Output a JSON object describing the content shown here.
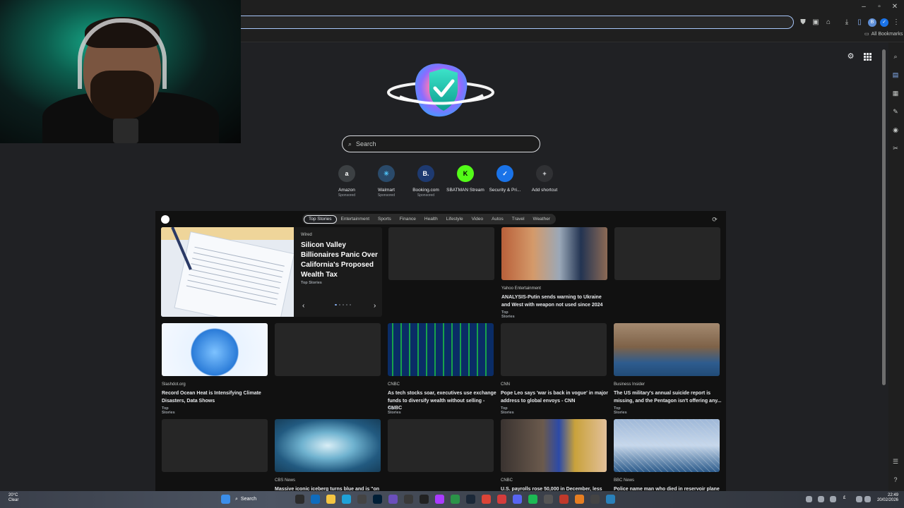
{
  "browser": {
    "bookmarks_label": "All Bookmarks",
    "window_controls": [
      "–",
      "▫",
      "✕"
    ]
  },
  "newtab": {
    "search_placeholder": "Search",
    "shortcuts": [
      {
        "label": "Amazon",
        "sub": "Sponsored",
        "icon": "a",
        "color": "#ffffff",
        "bg": "#3c4043"
      },
      {
        "label": "Walmart",
        "sub": "Sponsored",
        "icon": "✳",
        "color": "#4fc3f7",
        "bg": "#2a4a6a"
      },
      {
        "label": "Booking.com",
        "sub": "Sponsored",
        "icon": "B.",
        "color": "#ffffff",
        "bg": "#1e3a70"
      },
      {
        "label": "SBATMAN Stream",
        "sub": "",
        "icon": "K",
        "color": "#000000",
        "bg": "#53fc18"
      },
      {
        "label": "Security & Pri...",
        "sub": "",
        "icon": "✓",
        "color": "#ffffff",
        "bg": "#1a73e8"
      },
      {
        "label": "Add shortcut",
        "sub": "",
        "icon": "+",
        "color": "#e8eaed",
        "bg": "#303134"
      }
    ]
  },
  "feed": {
    "tabs": [
      "Top Stories",
      "Entertainment",
      "Sports",
      "Finance",
      "Health",
      "Lifestyle",
      "Video",
      "Autos",
      "Travel",
      "Weather"
    ],
    "hero": {
      "source": "Wired",
      "title": "Silicon Valley Billionaires Panic Over California's Proposed Wealth Tax",
      "category": "Top Stories",
      "prev": "‹",
      "next": "›"
    },
    "cards": [
      {
        "source": "",
        "title": "",
        "category": ""
      },
      {
        "source": "Yahoo Entertainment",
        "title": "ANALYSIS-Putin sends warning to Ukraine and West with weapon not used since 2024",
        "category": "Top Stories"
      },
      {
        "source": "",
        "title": "",
        "category": ""
      },
      {
        "source": "Slashdot.org",
        "title": "Record Ocean Heat is Intensifying Climate Disasters, Data Shows",
        "category": "Top Stories"
      },
      {
        "source": "",
        "title": "",
        "category": ""
      },
      {
        "source": "CNBC",
        "title": "As tech stocks soar, executives use exchange funds to diversify wealth without selling - CNBC",
        "category": "Top Stories"
      },
      {
        "source": "CNN",
        "title": "Pope Leo says 'war is back in vogue' in major address to global envoys - CNN",
        "category": "Top Stories"
      },
      {
        "source": "Business Insider",
        "title": "The US military's annual suicide report is missing, and the Pentagon isn't offering any...",
        "category": "Top Stories"
      },
      {
        "source": "",
        "title": "",
        "category": ""
      },
      {
        "source": "CBS News",
        "title": "Massive iconic iceberg turns blue and is \"on the",
        "category": ""
      },
      {
        "source": "",
        "title": "",
        "category": ""
      },
      {
        "source": "CNBC",
        "title": "U.S. payrolls rose 50,000 in December, less",
        "category": ""
      },
      {
        "source": "BBC News",
        "title": "Police name man who died in reservoir plane",
        "category": ""
      }
    ]
  },
  "taskbar": {
    "weather_temp": "20°C",
    "weather_cond": "Clear",
    "search_label": "Search",
    "time": "22:49",
    "date": "20/02/2026",
    "lang": "£"
  }
}
